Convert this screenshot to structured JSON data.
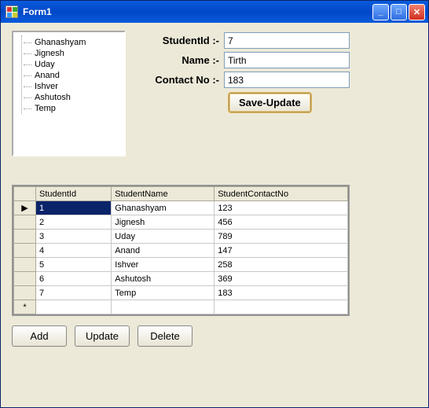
{
  "window": {
    "title": "Form1"
  },
  "tree": {
    "items": [
      {
        "label": "Ghanashyam"
      },
      {
        "label": "Jignesh"
      },
      {
        "label": "Uday"
      },
      {
        "label": "Anand"
      },
      {
        "label": "Ishver"
      },
      {
        "label": "Ashutosh"
      },
      {
        "label": "Temp"
      }
    ]
  },
  "form": {
    "studentid_label": "StudentId :-",
    "name_label": "Name :-",
    "contact_label": "Contact No :-",
    "studentid_value": "7",
    "name_value": "Tirth",
    "contact_value": "183",
    "save_label": "Save-Update"
  },
  "grid": {
    "columns": [
      "StudentId",
      "StudentName",
      "StudentContactNo"
    ],
    "rows": [
      {
        "id": "1",
        "name": "Ghanashyam",
        "contact": "123",
        "selected": true
      },
      {
        "id": "2",
        "name": "Jignesh",
        "contact": "456"
      },
      {
        "id": "3",
        "name": "Uday",
        "contact": "789"
      },
      {
        "id": "4",
        "name": "Anand",
        "contact": "147"
      },
      {
        "id": "5",
        "name": "Ishver",
        "contact": "258"
      },
      {
        "id": "6",
        "name": "Ashutosh",
        "contact": "369"
      },
      {
        "id": "7",
        "name": "Temp",
        "contact": "183"
      }
    ],
    "current_marker": "▶",
    "new_marker": "*"
  },
  "buttons": {
    "add": "Add",
    "update": "Update",
    "delete": "Delete"
  }
}
